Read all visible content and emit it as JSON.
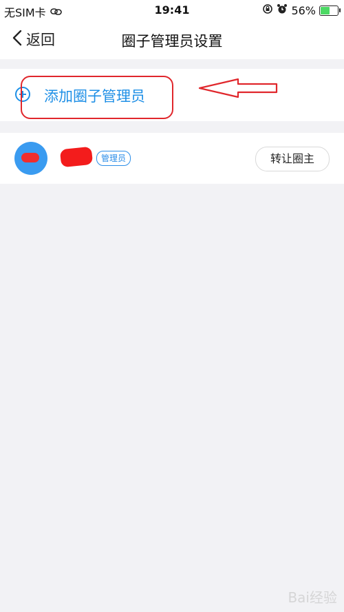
{
  "status_bar": {
    "carrier": "无SIM卡",
    "time": "19:41",
    "battery": "56%",
    "battery_level": 0.56
  },
  "nav": {
    "back_label": "返回",
    "title": "圈子管理员设置"
  },
  "add_admin": {
    "label": "添加圈子管理员"
  },
  "member": {
    "role_badge": "管理员",
    "transfer_button": "转让圈主"
  },
  "watermark": "Bai经验",
  "colors": {
    "accent": "#1e8fe6",
    "annotation": "#e0262b",
    "background": "#f2f2f5"
  }
}
